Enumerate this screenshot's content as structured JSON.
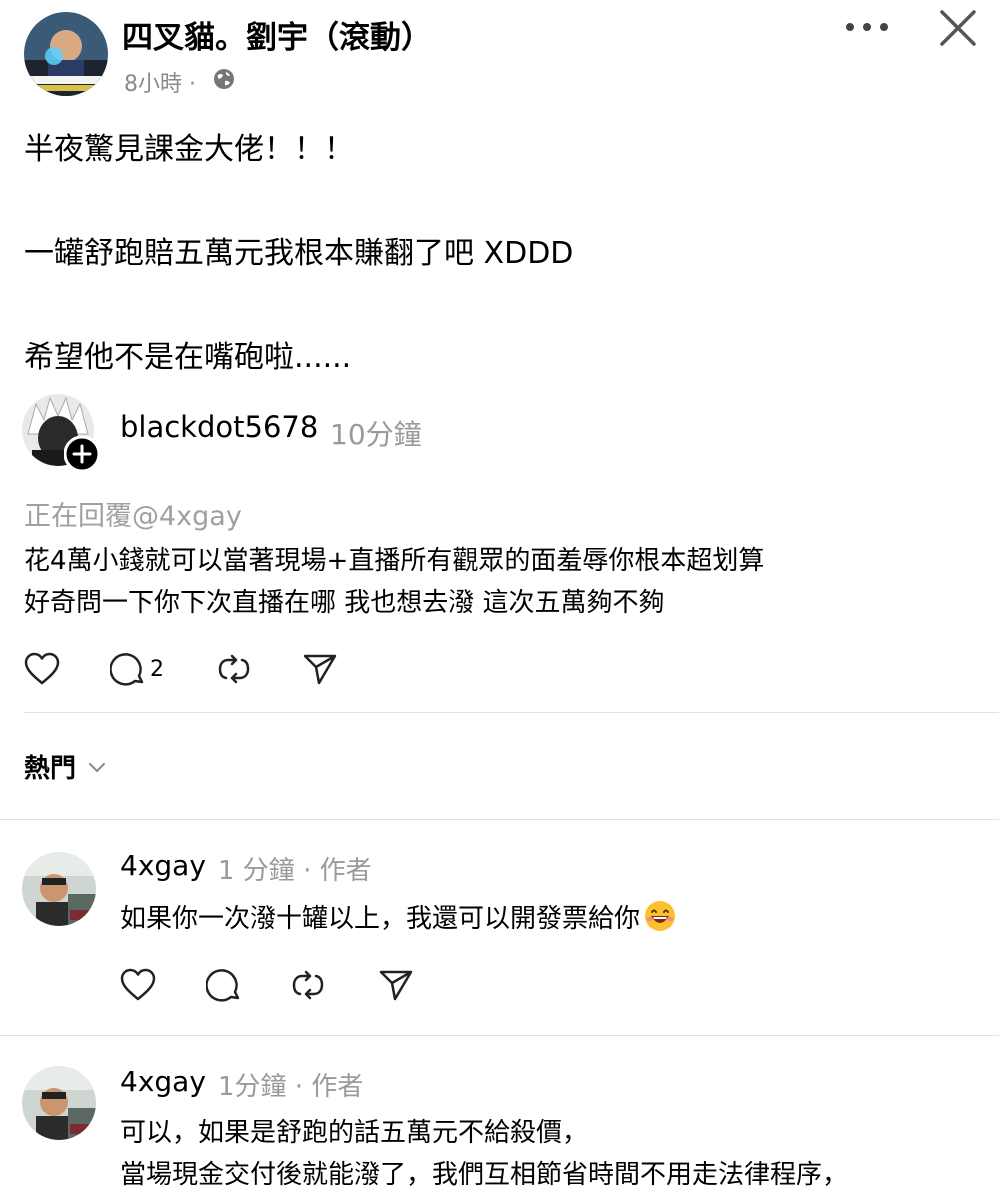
{
  "post": {
    "author": "四叉貓。劉宇（滾動）",
    "time": "8小時 ·",
    "lines": [
      "半夜驚見課金大佬！！！",
      "一罐舒跑賠五萬元我根本賺翻了吧 XDDD",
      "希望他不是在嘴砲啦......"
    ]
  },
  "header": {
    "more_icon": "more-horizontal-icon",
    "close_icon": "close-icon"
  },
  "quoted_reply": {
    "username": "blackdot5678",
    "time": "10分鐘",
    "replying_to": "正在回覆@4xgay",
    "lines": [
      "花4萬小錢就可以當著現場+直播所有觀眾的面羞辱你根本超划算",
      "好奇問一下你下次直播在哪 我也想去潑 這次五萬夠不夠"
    ],
    "comment_count": "2"
  },
  "sort": {
    "label": "熱門"
  },
  "comments": [
    {
      "username": "4xgay",
      "meta": "1 分鐘 · 作者",
      "lines": [
        "如果你一次潑十罐以上，我還可以開發票給你"
      ]
    },
    {
      "username": "4xgay",
      "meta": "1分鐘 · 作者",
      "lines": [
        "可以，如果是舒跑的話五萬元不給殺價，",
        "當場現金交付後就能潑了，我們互相節省時間不用走法律程序，"
      ]
    }
  ],
  "colors": {
    "text": "#000000",
    "muted": "#9a9a9a",
    "divider": "#e2e2e2"
  }
}
